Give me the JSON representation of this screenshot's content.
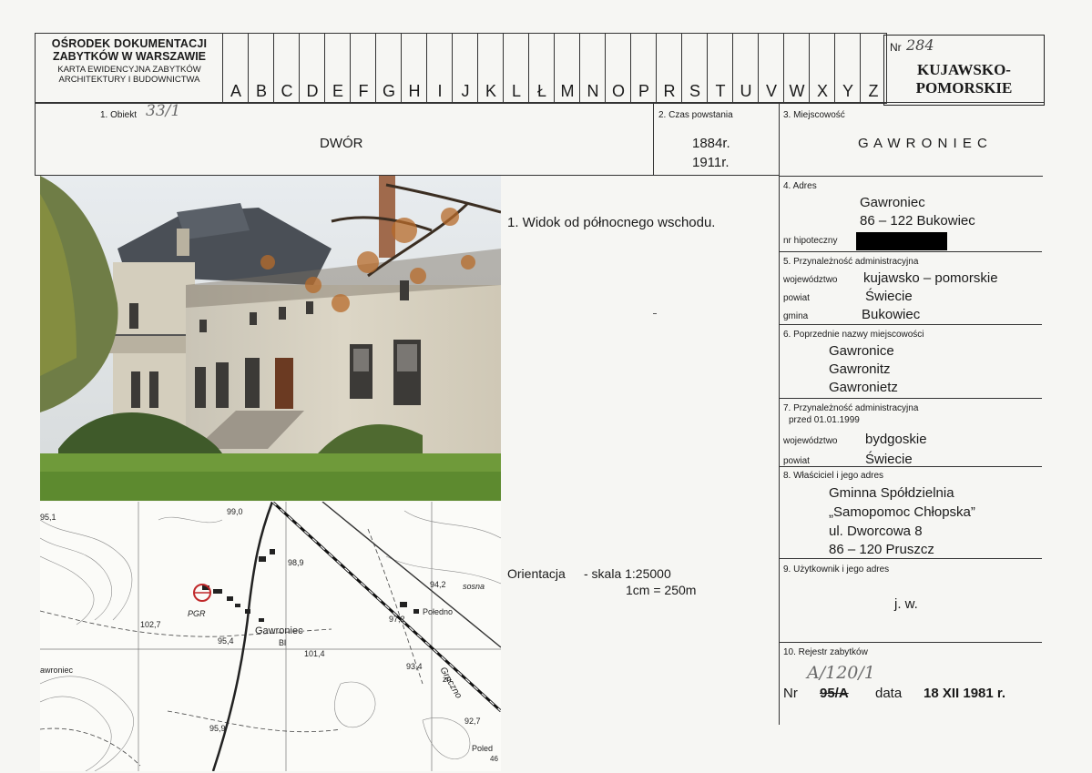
{
  "header": {
    "institution_line1": "OŚRODEK DOKUMENTACJI",
    "institution_line2": "ZABYTKÓW W WARSZAWIE",
    "card_title_line1": "KARTA EWIDENCYJNA ZABYTKÓW",
    "card_title_line2": "ARCHITEKTURY I BUDOWNICTWA",
    "letters": [
      "A",
      "B",
      "C",
      "D",
      "E",
      "F",
      "G",
      "H",
      "I",
      "J",
      "K",
      "L",
      "Ł",
      "M",
      "N",
      "O",
      "P",
      "R",
      "S",
      "T",
      "U",
      "V",
      "W",
      "X",
      "Y",
      "Z"
    ],
    "nr_label": "Nr",
    "nr_value": "284",
    "region_line1": "KUJAWSKO-",
    "region_line2": "POMORSKIE"
  },
  "fields": {
    "obiekt_label": "1. Obiekt",
    "obiekt_handwritten": "33/1",
    "obiekt_value": "DWÓR",
    "czas_label": "2. Czas powstania",
    "czas_value1": "1884r.",
    "czas_value2": "1911r.",
    "miejscowosc_label": "3. Miejscowość",
    "miejscowosc_value": "G A W R O N I E C",
    "adres_label": "4. Adres",
    "adres_line1": "Gawroniec",
    "adres_line2": "86 – 122 Bukowiec",
    "nr_hipoteczny_label": "nr hipoteczny",
    "admin_label": "5. Przynależność administracyjna",
    "wojewodztwo_label": "województwo",
    "wojewodztwo_value": "kujawsko – pomorskie",
    "powiat_label": "powiat",
    "powiat_value": "Świecie",
    "gmina_label": "gmina",
    "gmina_value": "Bukowiec",
    "poprzednie_label": "6. Poprzednie nazwy miejscowości",
    "poprzednie": [
      "Gawronice",
      "Gawronitz",
      "Gawronietz"
    ],
    "admin_old_label1": "7. Przynależność administracyjna",
    "admin_old_label2": "przed 01.01.1999",
    "old_wojewodztwo_label": "województwo",
    "old_wojewodztwo_value": "bydgoskie",
    "old_powiat_label": "powiat",
    "old_powiat_value": "Świecie",
    "wlasciciel_label": "8. Właściciel i jego adres",
    "wlasciciel_lines": [
      "Gminna Spółdzielnia",
      "„Samopomoc Chłopska”",
      "ul. Dworcowa  8",
      "86 – 120 Pruszcz"
    ],
    "uzytkownik_label": "9. Użytkownik i jego adres",
    "uzytkownik_value": "j. w.",
    "rejestr_label": "10. Rejestr zabytków",
    "rejestr_handwritten": "A/120/1",
    "rejestr_nr_label": "Nr",
    "rejestr_nr_value": "95/A",
    "rejestr_data_label": "data",
    "rejestr_data_value": "18 XII 1981 r."
  },
  "photo_caption": "1.  Widok od północnego wschodu.",
  "orientation": {
    "label": "Orientacja",
    "scale": "- skala 1:25000",
    "unit": "1cm  =  250m"
  },
  "map_labels": {
    "elev1": "99,0",
    "elev2": "98,9",
    "elev3": "97,2",
    "elev4": "102,7",
    "elev5": "95,4",
    "elev6": "101,4",
    "elev7": "93,4",
    "elev8": "92,7",
    "elev9": "95,9",
    "elev10": "94,2",
    "elev11": "95,1",
    "pgr": "PGR",
    "town": "Gawroniec",
    "bl": "Bl",
    "poledno": "Połedno",
    "poled": "Poled",
    "sosna": "sosna",
    "gruczno": "Gruczno",
    "zn": "zn.",
    "left_town": "awroniec",
    "num46": "46"
  },
  "colors": {
    "ink": "#1a1a1a",
    "paper": "#f6f6f3",
    "redact": "#000000"
  }
}
